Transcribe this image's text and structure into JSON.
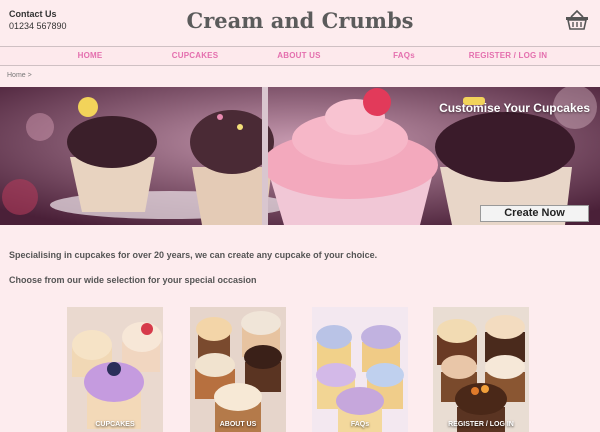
{
  "header": {
    "contact_title": "Contact Us",
    "contact_phone": "01234 567890",
    "site_title": "Cream and Crumbs",
    "basket_icon": "basket-icon"
  },
  "nav": {
    "items": [
      {
        "label": "HOME"
      },
      {
        "label": "CUPCAKES"
      },
      {
        "label": "ABOUT US"
      },
      {
        "label": "FAQs"
      },
      {
        "label": "REGISTER / LOG IN"
      }
    ]
  },
  "breadcrumb": "Home >",
  "hero": {
    "caption": "Customise Your Cupcakes",
    "button_label": "Create Now"
  },
  "main": {
    "intro": "Specialising in cupcakes for over 20 years, we can create any cupcake of your choice.",
    "subtext": "Choose from our wide selection for your special occasion"
  },
  "tiles": [
    {
      "label": "CUPCAKES"
    },
    {
      "label": "ABOUT US"
    },
    {
      "label": "FAQs"
    },
    {
      "label": "REGISTER / LOG IN"
    }
  ],
  "colors": {
    "background": "#fdecee",
    "nav_text": "#e46fae",
    "title": "#5b5b5b"
  }
}
